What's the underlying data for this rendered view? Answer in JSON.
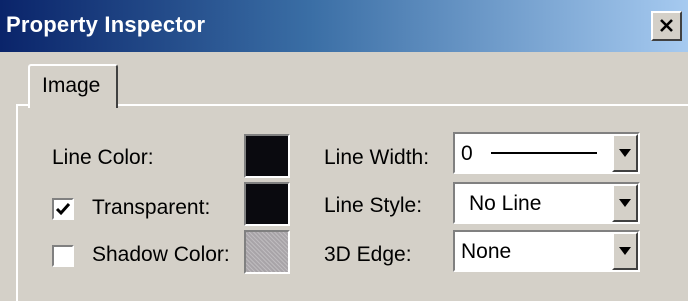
{
  "window": {
    "title": "Property Inspector"
  },
  "tabs": [
    {
      "label": "Image",
      "selected": true
    }
  ],
  "fields": {
    "line_color": {
      "label": "Line Color:",
      "color": "#000000"
    },
    "transparent": {
      "label": "Transparent:",
      "checked": true,
      "color": "#000000"
    },
    "shadow_color": {
      "label": "Shadow Color:",
      "checked": false,
      "color": "#a8a4a8"
    },
    "line_width": {
      "label": "Line Width:",
      "value": "0"
    },
    "line_style": {
      "label": "Line Style:",
      "value": "No Line"
    },
    "edge_3d": {
      "label": "3D Edge:",
      "value": "None"
    }
  },
  "colors": {
    "title_gradient_start": "#0a246a",
    "title_gradient_end": "#a6caf0",
    "face": "#d4d0c8"
  },
  "icons": {
    "close": "close-icon",
    "check": "checkmark-icon",
    "dropdown": "chevron-down-icon"
  }
}
